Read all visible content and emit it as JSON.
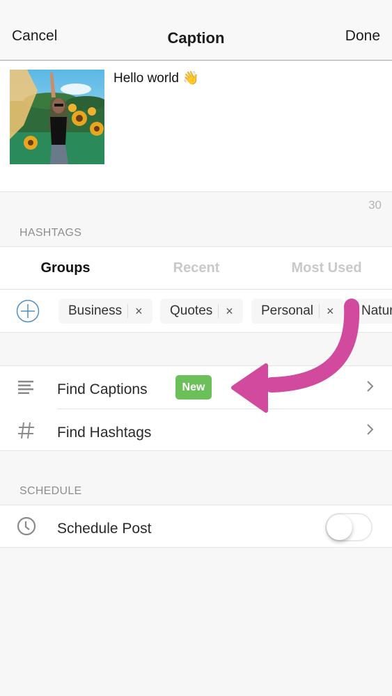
{
  "navbar": {
    "cancel_label": "Cancel",
    "title": "Caption",
    "done_label": "Done"
  },
  "compose": {
    "caption_text": "Hello world 👋",
    "character_count": "30"
  },
  "hashtags": {
    "section_label": "HASHTAGS",
    "tabs": [
      {
        "label": "Groups",
        "active": true
      },
      {
        "label": "Recent",
        "active": false
      },
      {
        "label": "Most Used",
        "active": false
      }
    ],
    "groups": [
      {
        "label": "Business"
      },
      {
        "label": "Quotes"
      },
      {
        "label": "Personal"
      },
      {
        "label": "Natur"
      }
    ],
    "remove_glyph": "×"
  },
  "finders": {
    "items": [
      {
        "label": "Find Captions",
        "badge": "New",
        "icon": "text-lines-icon"
      },
      {
        "label": "Find Hashtags",
        "icon": "hashtag-icon"
      }
    ]
  },
  "schedule": {
    "section_label": "SCHEDULE",
    "item_label": "Schedule Post",
    "toggle_on": false
  },
  "colors": {
    "accent_blue": "#4a90c8",
    "badge_green": "#6cc05a",
    "annotation_arrow": "#d24a9e"
  }
}
